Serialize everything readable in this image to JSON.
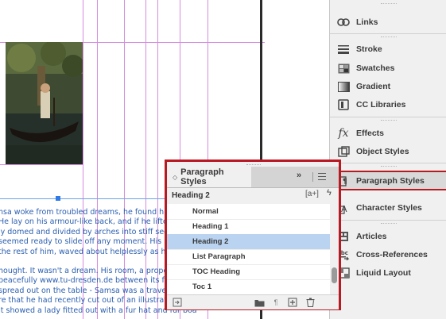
{
  "document": {
    "body_lines": [
      "nsa woke from troubled dreams, he found himself tr",
      " He lay on his armour-like back, and if he lifted his h",
      "ly domed and divided by arches into stiff sections. T",
      "seemed ready to slide off any moment. His many le",
      "the rest of him, waved about helplessly as he looked",
      "",
      "hought. It wasn't a dream. His room, a proper huma",
      "peacefully www.tu-dresden.de between its four famil",
      " spread out on the table - Samsa was a travelling sa",
      "re that he had recently cut out of an illustrated mag",
      "It showed a lady fitted out with a fur hat and fur boa"
    ]
  },
  "right_panel": {
    "items": [
      {
        "label": "Links",
        "icon": "links-icon"
      },
      {
        "label": "Stroke",
        "icon": "stroke-icon"
      },
      {
        "label": "Swatches",
        "icon": "swatches-icon"
      },
      {
        "label": "Gradient",
        "icon": "gradient-icon"
      },
      {
        "label": "CC Libraries",
        "icon": "cc-libraries-icon"
      },
      {
        "label": "Effects",
        "icon": "effects-icon"
      },
      {
        "label": "Object Styles",
        "icon": "object-styles-icon"
      },
      {
        "label": "Paragraph Styles",
        "icon": "paragraph-styles-icon",
        "active": true
      },
      {
        "label": "Character Styles",
        "icon": "character-styles-icon"
      },
      {
        "label": "Articles",
        "icon": "articles-icon"
      },
      {
        "label": "Cross-References",
        "icon": "cross-references-icon"
      },
      {
        "label": "Liquid Layout",
        "icon": "liquid-layout-icon"
      }
    ]
  },
  "paragraph_panel": {
    "tab_collapse_glyph": "◇",
    "title": "Paragraph Styles",
    "expand_glyph": "»",
    "current_style": "Heading 2",
    "new_override_glyph": "[a+]",
    "lightning_glyph": "ϟ",
    "styles": [
      "Normal",
      "Heading 1",
      "Heading 2",
      "List Paragraph",
      "TOC Heading",
      "Toc 1"
    ],
    "selected_style": "Heading 2"
  },
  "colors": {
    "accent_red": "#b81a22",
    "selection_blue": "#b9d3f1",
    "guide_magenta": "#d68be0",
    "text_blue": "#2b5fb0"
  }
}
